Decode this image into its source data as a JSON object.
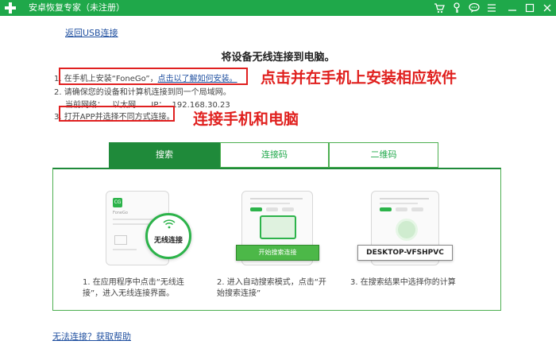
{
  "window": {
    "title": "安卓恢复专家（未注册）",
    "buttons": [
      "cart-icon",
      "key-icon",
      "chat-icon",
      "menu-icon",
      "minimize-icon",
      "maximize-icon",
      "close-icon"
    ]
  },
  "back_link": "返回USB连接",
  "heading": "将设备无线连接到电脑。",
  "steps": {
    "s1_prefix": "1. 在手机上安装“FoneGo”，",
    "s1_link": "点击以了解如何安装。",
    "s2": "2. 请确保您的设备和计算机连接到同一个局域网。",
    "s2_net_label": "当前网络：",
    "s2_net_type": "以太网",
    "s2_ip_label": "IP：",
    "s2_ip": "192.168.30.23",
    "s3": "3. 打开APP并选择不同方式连接。"
  },
  "annotations": {
    "a1": "点击并在手机上安装相应软件",
    "a2": "连接手机和电脑"
  },
  "tabs": [
    {
      "label": "搜索",
      "active": true
    },
    {
      "label": "连接码",
      "active": false
    },
    {
      "label": "二维码",
      "active": false
    }
  ],
  "cards": {
    "c1": {
      "app_label": "FoneGo",
      "bubble": "无线连接",
      "caption": "1. 在应用程序中点击“无线连接”，进入无线连接界面。"
    },
    "c2": {
      "button": "开始搜索连接",
      "caption": "2. 进入自动搜索模式，点击“开始搜索连接”"
    },
    "c3": {
      "device_name": "DESKTOP-VFSHPVC",
      "caption": "3. 在搜索结果中选择你的计算"
    }
  },
  "help_link": "无法连接？获取帮助",
  "colors": {
    "brand": "#1fa84a",
    "tab_active": "#1f8a3a",
    "annotation": "#e0201e",
    "link": "#2050a0"
  }
}
